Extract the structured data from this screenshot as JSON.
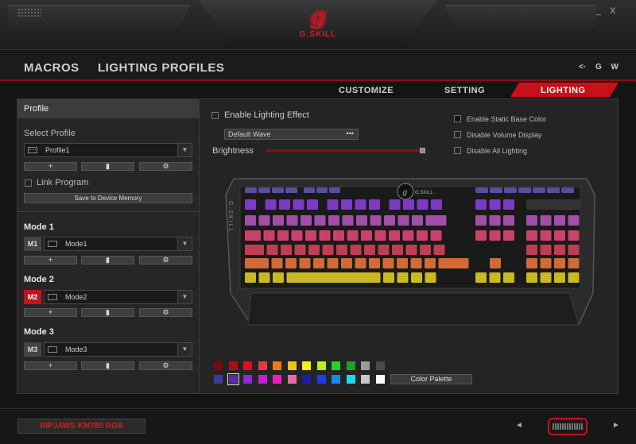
{
  "window": {
    "brand": "G.SKILL",
    "minimize": "_",
    "close": "X"
  },
  "nav": {
    "macros": "MACROS",
    "lighting_profiles": "LIGHTING PROFILES",
    "right_icons": [
      "share-icon",
      "G",
      "W"
    ]
  },
  "tabs": {
    "customize": "CUSTOMIZE",
    "setting": "SETTING",
    "lighting": "LIGHTING",
    "active": "lighting"
  },
  "profile": {
    "header": "Profile",
    "select_label": "Select Profile",
    "selected": "Profile1",
    "buttons": [
      "+",
      "lock-icon",
      "gear-icon"
    ],
    "link_program": "Link Program",
    "save_button": "Save to Device Memory"
  },
  "modes": [
    {
      "title": "Mode 1",
      "badge": "M1",
      "value": "Mode1",
      "active": false
    },
    {
      "title": "Mode 2",
      "badge": "M2",
      "value": "Mode2",
      "active": true
    },
    {
      "title": "Mode 3",
      "badge": "M3",
      "value": "Mode3",
      "active": false
    }
  ],
  "lighting": {
    "enable_effect": "Enable Lighting Effect",
    "effect": "Default Wave",
    "brightness_label": "Brightness",
    "brightness_level": 1.0,
    "options": [
      "Enable Static Base Color",
      "Disable Volume Display",
      "Disable All Lighting"
    ]
  },
  "keyboard": {
    "logo": "G.SKILL",
    "side_text": "G.SKILL",
    "row_colors": [
      "#7c3bc4",
      "#a34ea8",
      "#c9426b",
      "#c23d52",
      "#d36a35",
      "#c9b824"
    ]
  },
  "palette": {
    "row1": [
      "#7a0a0a",
      "#b00d14",
      "#e0101a",
      "#e63a3a",
      "#f07a1a",
      "#f2c21a",
      "#f2f21a",
      "#b4f21a",
      "#2ad11a",
      "#1aa32a",
      "#9a9a9a",
      "#4a4a4a"
    ],
    "row2": [
      "#3a3a9e",
      "#5a2aa8",
      "#8a2ad8",
      "#c81ad8",
      "#f01ac8",
      "#e86aa0",
      "#1a1ab0",
      "#1a3af0",
      "#1a8af0",
      "#1ad8f0",
      "#c8c8c8",
      "#ffffff"
    ],
    "selected": "#5a2aa8",
    "button": "Color Palette"
  },
  "footer": {
    "product": "RIPJAWS KM780 RGB",
    "prev": "◄",
    "next": "►"
  }
}
